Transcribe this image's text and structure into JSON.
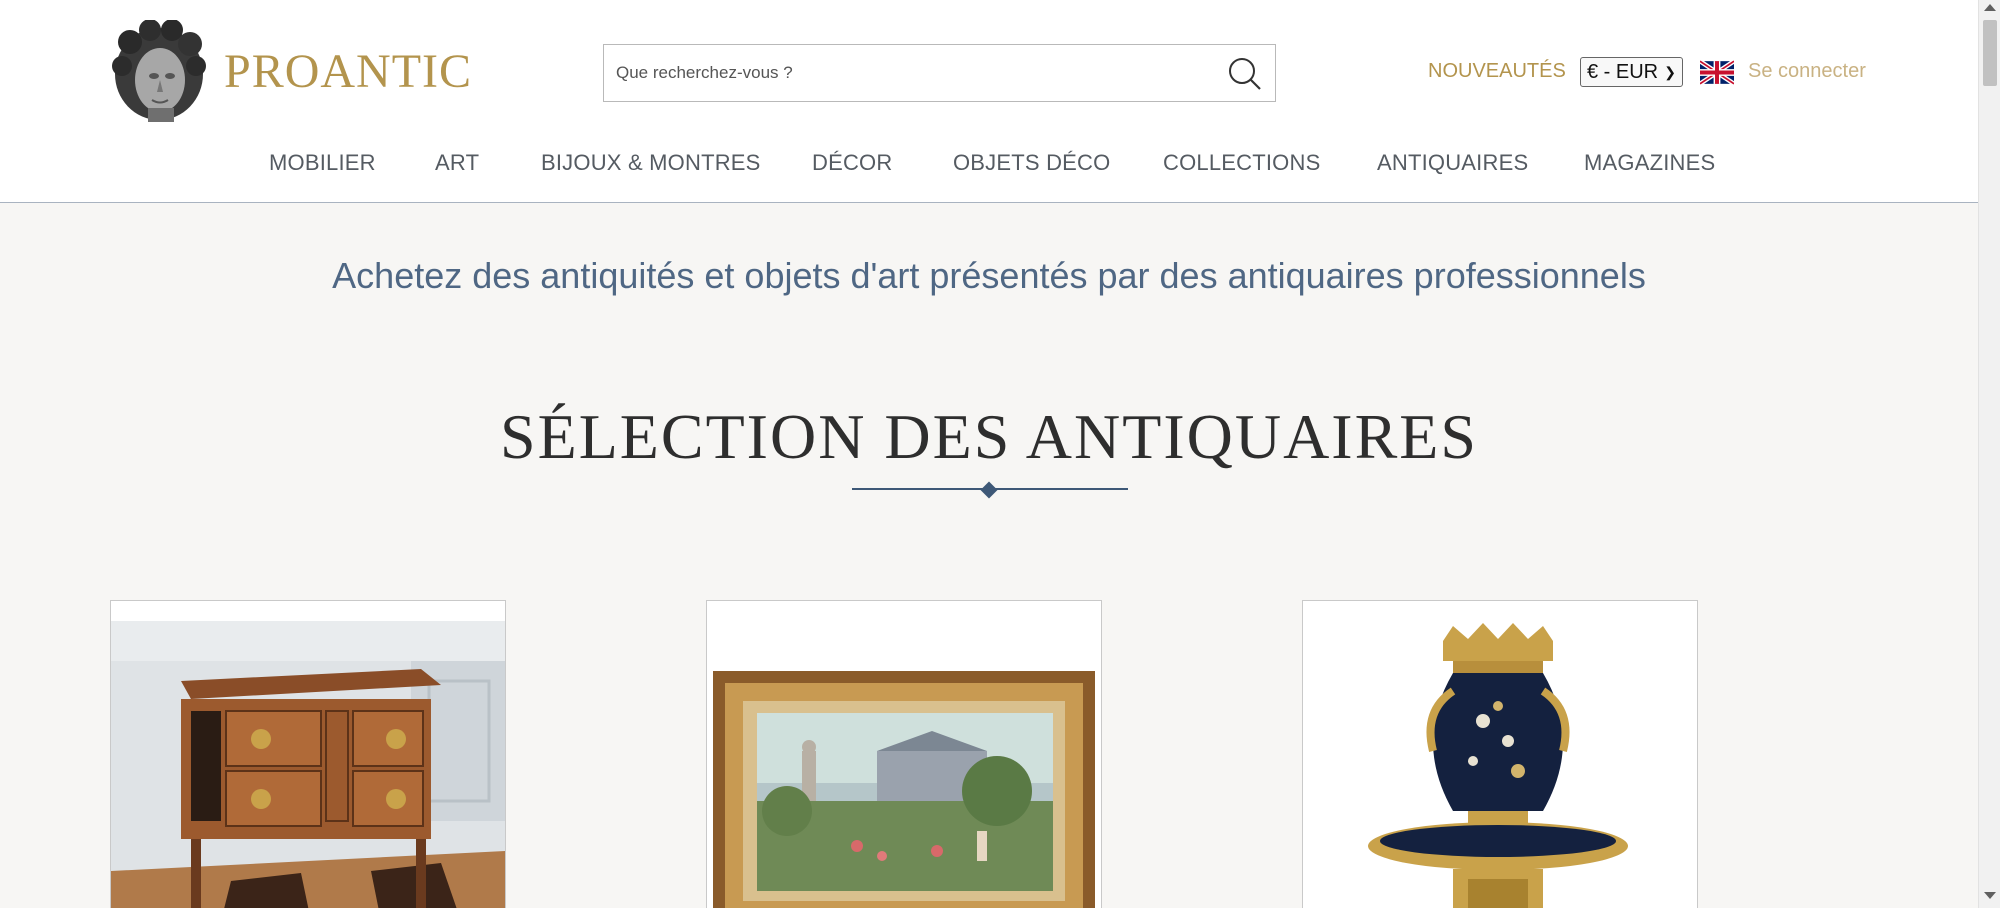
{
  "header": {
    "logo_text": "PROANTIC",
    "search": {
      "placeholder": "Que recherchez-vous ?",
      "value": ""
    },
    "nouveautes_label": "NOUVEAUTÉS",
    "currency": "€ - EUR",
    "login_label": "Se connecter",
    "language_flag": "uk-flag-icon"
  },
  "nav": {
    "items": [
      {
        "label": "MOBILIER"
      },
      {
        "label": "ART"
      },
      {
        "label": "BIJOUX & MONTRES"
      },
      {
        "label": "DÉCOR"
      },
      {
        "label": "OBJETS DÉCO"
      },
      {
        "label": "COLLECTIONS"
      },
      {
        "label": "ANTIQUAIRES"
      },
      {
        "label": "MAGAZINES"
      }
    ]
  },
  "main": {
    "tagline": "Achetez des antiquités et objets d'art présentés par des antiquaires professionnels",
    "section_title": "SÉLECTION DES ANTIQUAIRES",
    "cards": [
      {
        "subject": "commode-marquetry-image"
      },
      {
        "subject": "framed-painting-image"
      },
      {
        "subject": "vase-cobalt-gilt-image"
      }
    ]
  },
  "colors": {
    "brand_gold": "#b3944d",
    "navy": "#3e5877",
    "tagline": "#4f6784"
  }
}
